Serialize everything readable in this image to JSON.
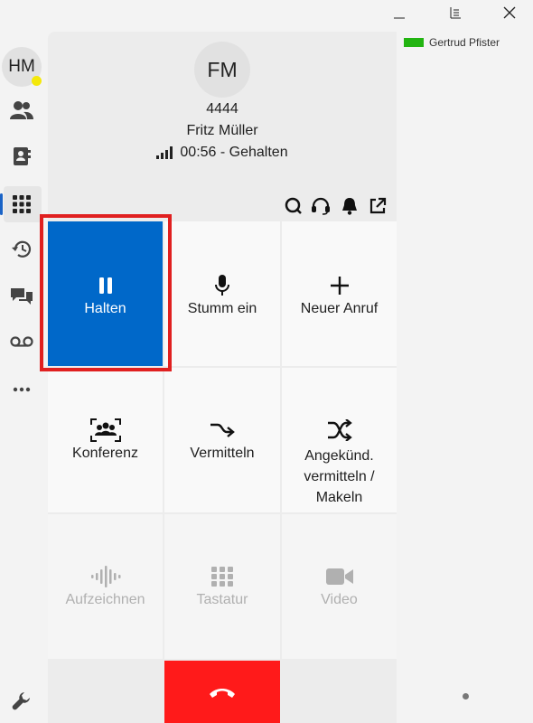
{
  "user": {
    "initials": "HM",
    "presence_color": "#f4e80a"
  },
  "call": {
    "initials": "FM",
    "number": "4444",
    "name": "Fritz Müller",
    "status": "00:56 - Gehalten"
  },
  "buttons": {
    "hold": "Halten",
    "mute": "Stumm ein",
    "new_call": "Neuer Anruf",
    "conference": "Konferenz",
    "transfer": "Vermitteln",
    "attended_transfer": "Angekünd. vermitteln / Makeln",
    "record": "Aufzeichnen",
    "keypad": "Tastatur",
    "video": "Video"
  },
  "contacts": [
    {
      "name": "Gertrud Pfister",
      "status_color": "#22b411"
    }
  ],
  "colors": {
    "accent": "#0068c9",
    "hangup": "#ff1a1a",
    "highlight": "#e02020"
  }
}
